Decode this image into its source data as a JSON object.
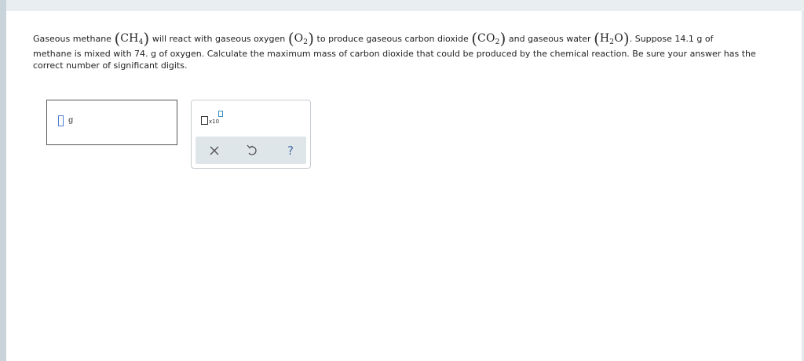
{
  "question": {
    "t1": "Gaseous methane",
    "methane_formula": "CH",
    "methane_sub": "4",
    "t2": "will react with gaseous oxygen",
    "oxygen_formula": "O",
    "oxygen_sub": "2",
    "t3": "to produce gaseous carbon dioxide",
    "co2_formula": "CO",
    "co2_sub": "2",
    "t4": "and gaseous water",
    "water_h": "H",
    "water_sub": "2",
    "water_o": "O",
    "t5": ". Suppose 14.1 g of",
    "rest": "methane is mixed with 74. g of oxygen. Calculate the maximum mass of carbon dioxide that could be produced by the chemical reaction. Be sure your answer has the correct number of significant digits."
  },
  "answer": {
    "value": "",
    "unit": "g"
  },
  "tools": {
    "sci_label": "x10",
    "help_label": "?",
    "icons": [
      "scientific-notation-icon",
      "clear-icon",
      "undo-icon",
      "help-icon"
    ]
  }
}
